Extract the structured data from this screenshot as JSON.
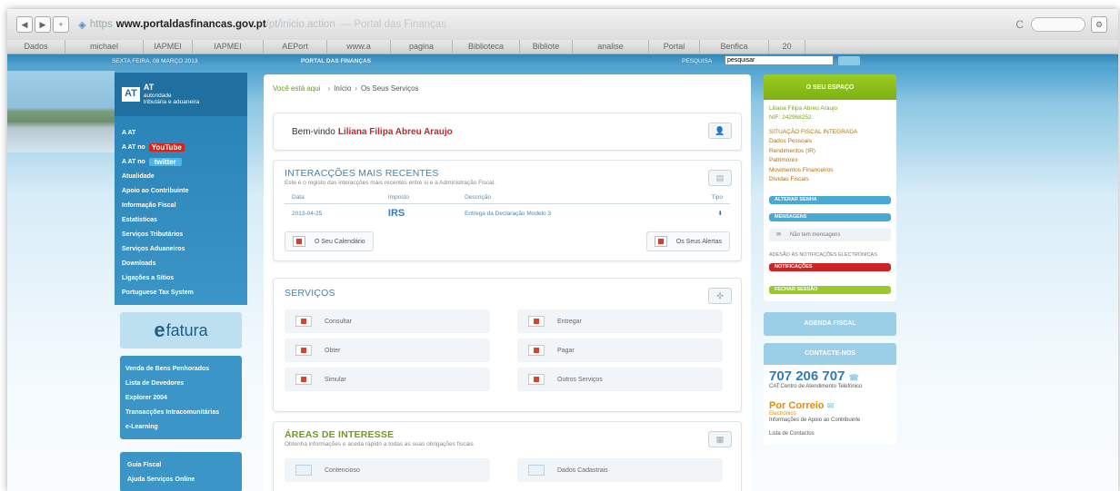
{
  "browser": {
    "https": "https",
    "host": "www.portaldasfinancas.gov.pt",
    "path": "/pt/inicio.action",
    "page_title": "— Portal das Finanças",
    "reload_icon": "reload-icon",
    "search_placeholder": "",
    "bookmarks": [
      "Dados",
      "michael",
      "IAPMEI",
      "IAPMEI",
      "AEPort",
      "www.a",
      "pagina",
      "Biblioteca",
      "Bibliote",
      "analise",
      "Portal",
      "Benfica",
      "20"
    ]
  },
  "header": {
    "date": "SEXTA FEIRA, 08 MARÇO 2013",
    "portal": "PORTAL DAS FINANÇAS",
    "search_label": "PESQUISA",
    "search_value": "pesquisar"
  },
  "sidebar": {
    "logo_mark": "AT",
    "logo_line1": "AT",
    "logo_line2": "autoridade",
    "logo_line3": "tributária e aduaneira",
    "menu1": [
      {
        "label": "A AT"
      },
      {
        "label": "A AT no",
        "badge": "YouTube"
      },
      {
        "label": "A AT no",
        "badge": "twitter"
      },
      {
        "label": "Atualidade"
      },
      {
        "label": "Apoio ao Contribuinte"
      },
      {
        "label": "Informação Fiscal"
      },
      {
        "label": "Estatísticas"
      },
      {
        "label": "Serviços Tributários"
      },
      {
        "label": "Serviços Aduaneiros"
      },
      {
        "label": "Downloads"
      },
      {
        "label": "Ligações a Sítios"
      },
      {
        "label": "Portuguese Tax System"
      }
    ],
    "efatura_e": "e",
    "efatura_rest": "fatura",
    "menu2": [
      "Venda de Bens Penhorados",
      "Lista de Devedores",
      "Explorer 2004",
      "Transacções Intracomunitárias",
      "e-Learning"
    ],
    "menu3": [
      "Guia Fiscal",
      "Ajuda Serviços Online"
    ]
  },
  "main": {
    "crumb_here": "Você está aqui",
    "crumb_items": [
      "Início",
      "Os Seus Serviços"
    ],
    "welcome_prefix": "Bem-vindo",
    "welcome_name": "Liliana Filipa Abreu Araujo",
    "inter_title": "INTERACÇÕES MAIS RECENTES",
    "inter_sub": "Este é o registo das interacções mais recentes entre si e a Administração Fiscal.",
    "table_headers": [
      "Data",
      "Imposto",
      "Descrição",
      "Tipo"
    ],
    "table_rows": [
      {
        "data": "2013-04-25",
        "imposto": "IRS",
        "descricao": "Entrega da Declaração Modelo 3"
      }
    ],
    "btn_calendar": "O Seu Calendário",
    "btn_alerts": "Os Seus Alertas",
    "serv_title": "SERVIÇOS",
    "services": [
      "Consultar",
      "Entregar",
      "Obter",
      "Pagar",
      "Simular",
      "Outros Serviços"
    ],
    "areas_title": "ÁREAS DE INTERESSE",
    "areas_sub": "Obtenha informações e aceda rápido a todas as suas obrigações fiscais",
    "areas": [
      "Contencioso",
      "Dados Cadastrais"
    ]
  },
  "right": {
    "espaco_title": "O SEU ESPAÇO",
    "user_name": "Liliana Filipa Abreu Araujo",
    "nif": "NIF: 242968252",
    "links": [
      "SITUAÇÃO FISCAL INTEGRADA",
      "Dados Pessoais",
      "Rendimentos (IR)",
      "Património",
      "Movimentos Financeiros",
      "Dívidas Fiscais"
    ],
    "alterar_senha": "ALTERAR SENHA",
    "mensagens": "MENSAGENS",
    "sem_mensagens": "Não tem mensagens",
    "adesao": "ADESÃO ÀS NOTIFICAÇÕES ELECTRÓNICAS",
    "notificacoes": "NOTIFICAÇÕES",
    "fechar": "FECHAR SESSÃO",
    "agenda": "AGENDA FISCAL",
    "contacte": "CONTACTE-NOS",
    "phone": "707 206 707",
    "cat": "CAT:Centro de Atendimento Telefónico",
    "correio": "Por Correio",
    "correio_sub": "Electrónico",
    "correio_info": "Informações de Apoio ao Contribuinte",
    "lista": "Lista de Contactos"
  },
  "colors": {
    "accent_blue": "#3d83b5",
    "accent_green": "#7db014",
    "accent_red": "#c0282c",
    "accent_orange": "#e58a0b"
  }
}
